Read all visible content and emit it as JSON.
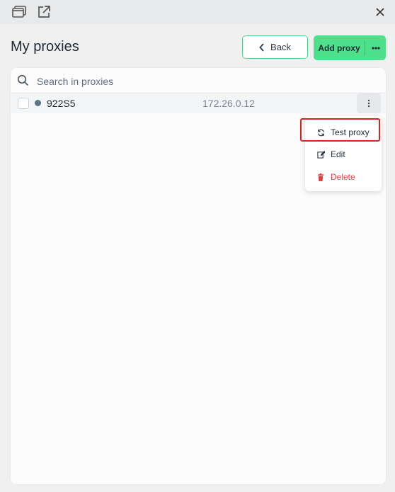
{
  "window": {
    "icons": [
      "window-icon",
      "popout-icon",
      "close-icon"
    ]
  },
  "header": {
    "title": "My proxies",
    "back_label": "Back",
    "add_label": "Add proxy",
    "more_label": "•••"
  },
  "search": {
    "placeholder": "Search in proxies",
    "value": ""
  },
  "proxies": [
    {
      "name": "922S5",
      "ip": "172.26.0.12",
      "status_color": "#5a7584",
      "checked": false
    }
  ],
  "row_menu_label": "⋮",
  "menu": {
    "items": [
      {
        "label": "Test proxy",
        "icon": "refresh-icon"
      },
      {
        "label": "Edit",
        "icon": "edit-icon"
      },
      {
        "label": "Delete",
        "icon": "trash-icon",
        "color": "#e53e3e"
      }
    ]
  },
  "colors": {
    "accent": "#4fe08c",
    "highlight": "#e0201c"
  }
}
